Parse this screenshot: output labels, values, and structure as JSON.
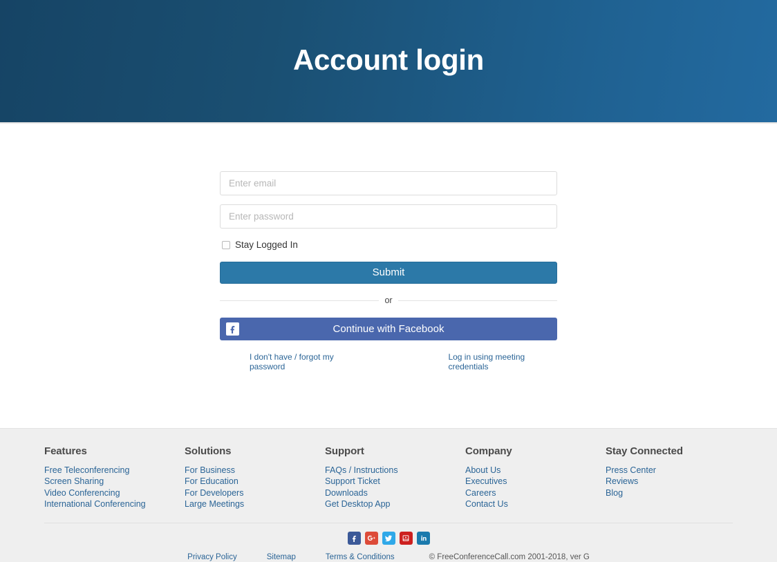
{
  "hero": {
    "title": "Account login"
  },
  "form": {
    "email_placeholder": "Enter email",
    "email_value": "",
    "password_placeholder": "Enter password",
    "password_value": "",
    "stay_logged_in_label": "Stay Logged In",
    "stay_logged_in_checked": false,
    "submit_label": "Submit",
    "divider_label": "or",
    "facebook_label": "Continue with Facebook",
    "forgot_password_link": "I don't have / forgot my password",
    "meeting_credentials_link": "Log in using meeting credentials"
  },
  "footer": {
    "columns": [
      {
        "heading": "Features",
        "links": [
          "Free Teleconferencing",
          "Screen Sharing",
          "Video Conferencing",
          "International Conferencing"
        ]
      },
      {
        "heading": "Solutions",
        "links": [
          "For Business",
          "For Education",
          "For Developers",
          "Large Meetings"
        ]
      },
      {
        "heading": "Support",
        "links": [
          "FAQs / Instructions",
          "Support Ticket",
          "Downloads",
          "Get Desktop App"
        ]
      },
      {
        "heading": "Company",
        "links": [
          "About Us",
          "Executives",
          "Careers",
          "Contact Us"
        ]
      },
      {
        "heading": "Stay Connected",
        "links": [
          "Press Center",
          "Reviews",
          "Blog"
        ]
      }
    ],
    "social": [
      {
        "name": "facebook",
        "color": "#3b5998"
      },
      {
        "name": "google-plus",
        "color": "#dd4b39"
      },
      {
        "name": "twitter",
        "color": "#2fa8e8"
      },
      {
        "name": "youtube",
        "color": "#cd201f"
      },
      {
        "name": "linkedin",
        "color": "#1b7aad"
      }
    ],
    "legal": {
      "privacy": "Privacy Policy",
      "sitemap": "Sitemap",
      "terms": "Terms & Conditions",
      "copyright": "© FreeConferenceCall.com 2001-2018, ver G"
    }
  },
  "colors": {
    "hero_gradient_start": "#164465",
    "hero_gradient_end": "#236aa0",
    "submit_button": "#2c79a8",
    "facebook_button": "#4a67ad",
    "link_blue": "#2a6496",
    "footer_background": "#efefef"
  }
}
